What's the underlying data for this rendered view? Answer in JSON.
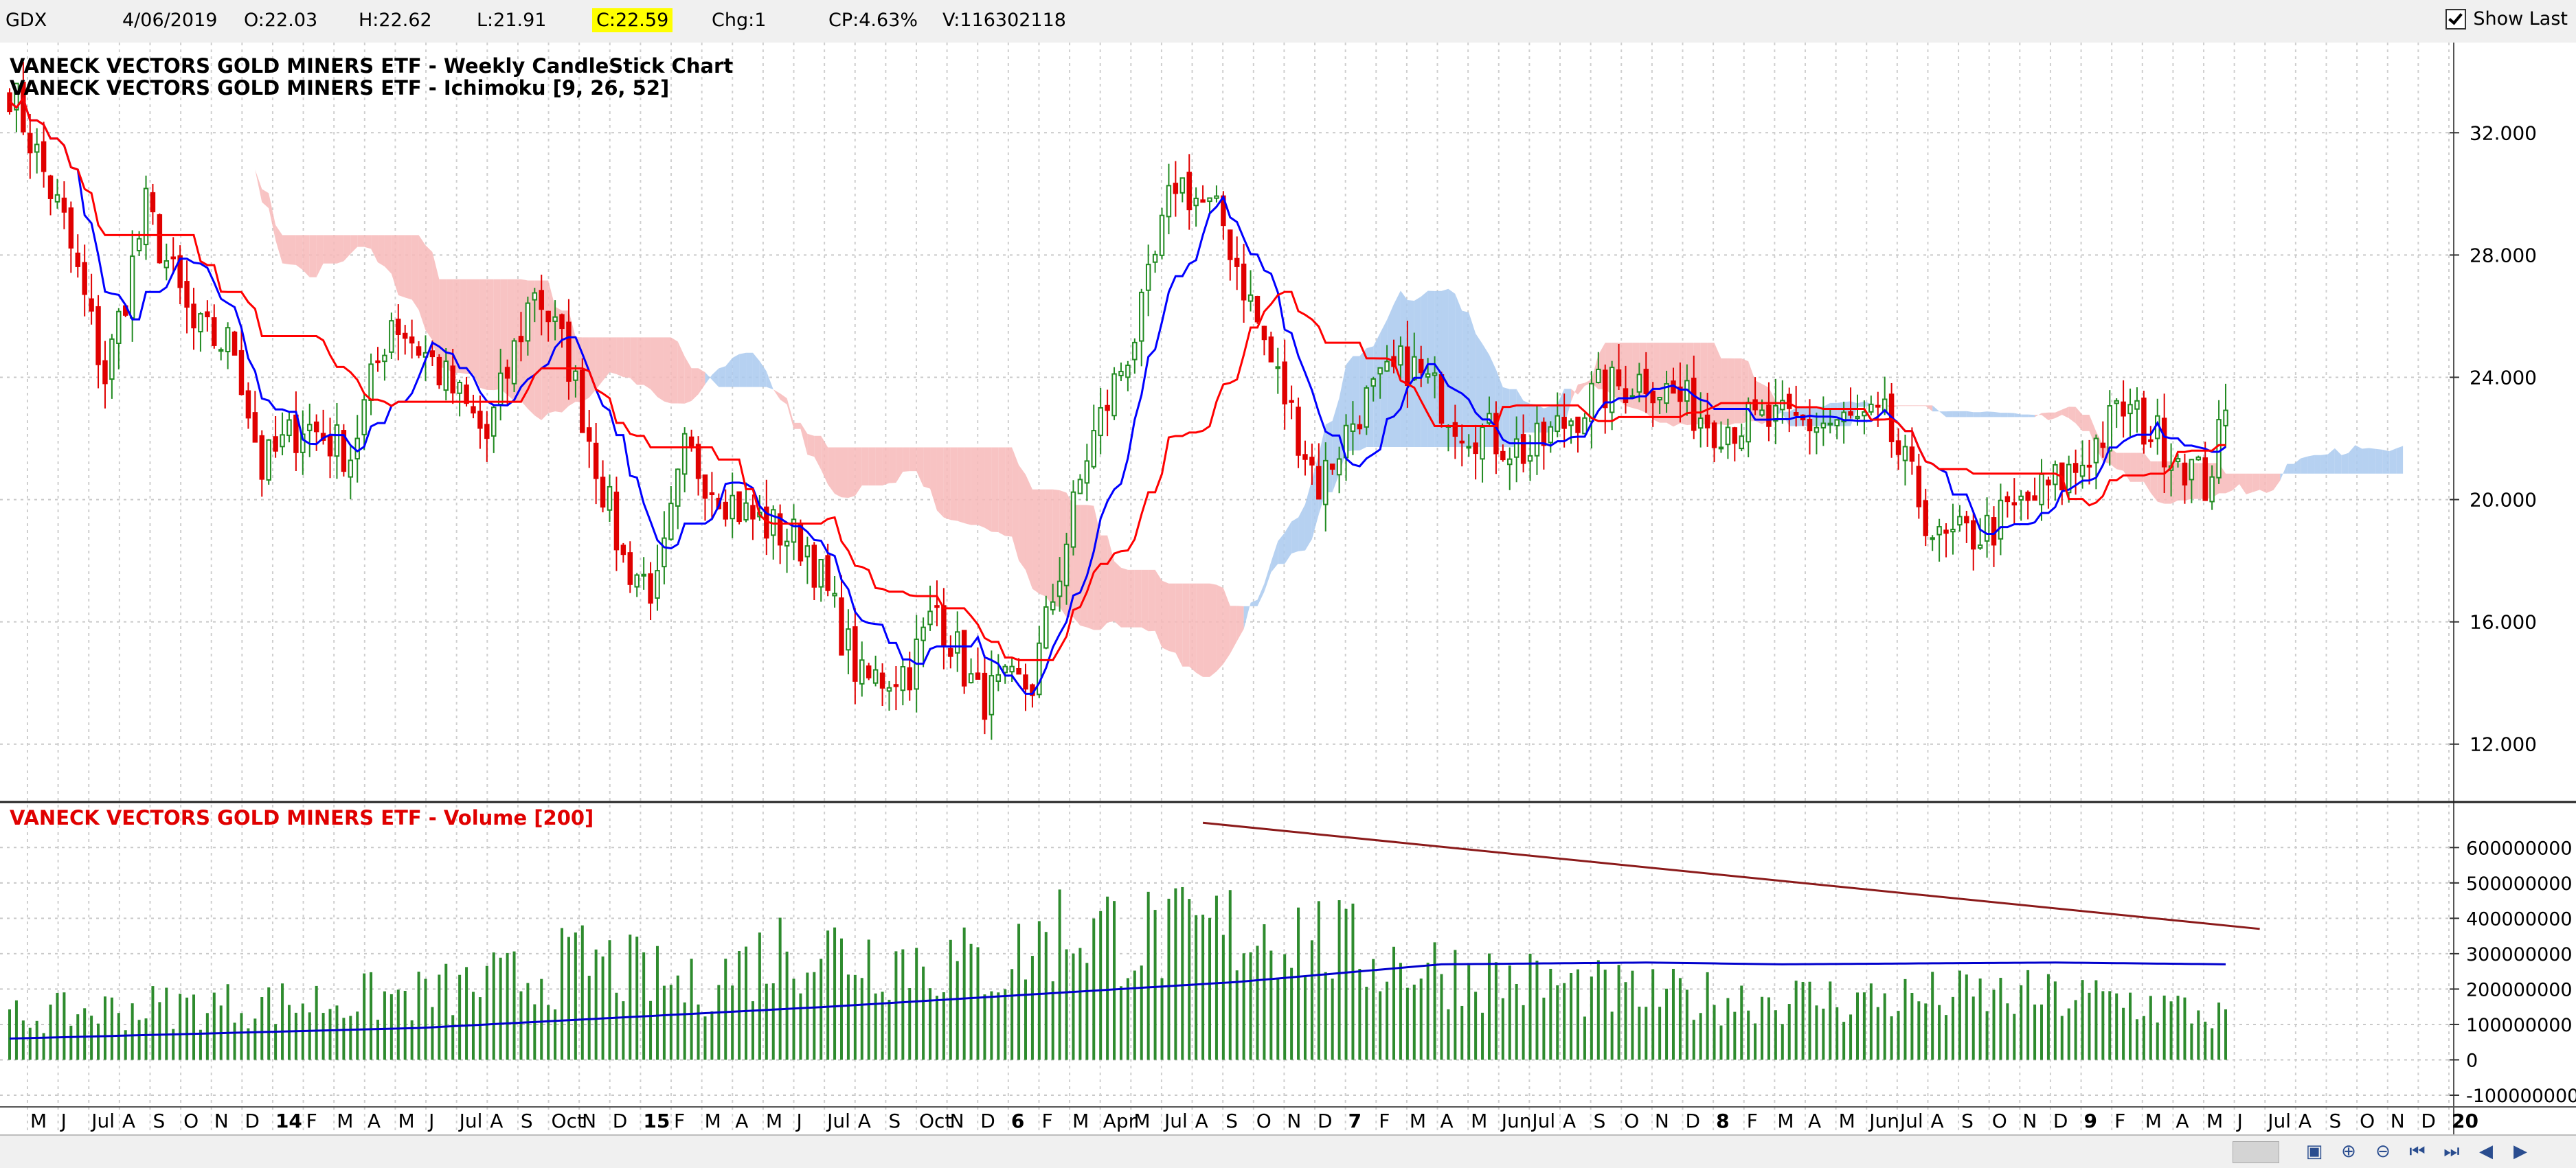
{
  "header": {
    "symbol": "GDX",
    "date": "4/06/2019",
    "open": "O:22.03",
    "high": "H:22.62",
    "low": "L:21.91",
    "close": "C:22.59",
    "change": "Chg:1",
    "change_pct": "CP:4.63%",
    "volume": "V:116302118",
    "show_last_label": "Show Last",
    "show_last_checked": true
  },
  "chart_data": [
    {
      "type": "candlestick",
      "title": "VANECK VECTORS GOLD MINERS ETF - Weekly CandleStick Chart",
      "subtitle": "VANECK VECTORS GOLD MINERS ETF - Ichimoku [9, 26, 52]",
      "ylim": [
        11.5,
        34.5
      ],
      "yticks": [
        "32.000",
        "28.000",
        "24.000",
        "20.000",
        "16.000",
        "12.000"
      ],
      "ytick_values": [
        32,
        28,
        24,
        20,
        16,
        12
      ],
      "up_color": "#228b22",
      "down_color": "#e00000",
      "tenkan_color": "#0000ff",
      "kijun_color": "#ff0000",
      "cloud_bear_color": "#f7b9b9",
      "cloud_bull_color": "#a9c9ef",
      "close_anchors": [
        [
          0,
          33.5
        ],
        [
          8,
          29
        ],
        [
          14,
          24
        ],
        [
          20,
          29.5
        ],
        [
          27,
          25.5
        ],
        [
          33,
          25
        ],
        [
          37,
          21
        ],
        [
          43,
          22.5
        ],
        [
          50,
          21.5
        ],
        [
          56,
          26
        ],
        [
          62,
          24.5
        ],
        [
          70,
          22
        ],
        [
          77,
          27
        ],
        [
          82,
          24.5
        ],
        [
          90,
          18
        ],
        [
          95,
          17
        ],
        [
          99,
          21.5
        ],
        [
          108,
          19.5
        ],
        [
          117,
          18.5
        ],
        [
          125,
          14
        ],
        [
          132,
          14.5
        ],
        [
          136,
          16.5
        ],
        [
          142,
          13.5
        ],
        [
          150,
          14
        ],
        [
          158,
          21.5
        ],
        [
          166,
          26
        ],
        [
          171,
          30.5
        ],
        [
          178,
          29
        ],
        [
          185,
          24.5
        ],
        [
          192,
          20.5
        ],
        [
          198,
          23
        ],
        [
          205,
          24.5
        ],
        [
          213,
          22.5
        ],
        [
          223,
          21.5
        ],
        [
          233,
          23.5
        ],
        [
          240,
          24
        ],
        [
          250,
          22.5
        ],
        [
          260,
          22.5
        ],
        [
          275,
          22.5
        ],
        [
          283,
          18.5
        ],
        [
          290,
          19
        ],
        [
          303,
          21
        ],
        [
          310,
          23
        ],
        [
          318,
          21.5
        ],
        [
          322,
          20.5
        ],
        [
          325,
          22.6
        ]
      ],
      "date_labels": [
        "M",
        "J",
        "Jul",
        "A",
        "S",
        "O",
        "N",
        "D",
        "14",
        "F",
        "M",
        "A",
        "M",
        "J",
        "Jul",
        "A",
        "S",
        "Oct",
        "N",
        "D",
        "15",
        "F",
        "M",
        "A",
        "M",
        "J",
        "Jul",
        "A",
        "S",
        "Oct",
        "N",
        "D",
        "6",
        "F",
        "M",
        "Apr",
        "M",
        "Jul",
        "A",
        "S",
        "O",
        "N",
        "D",
        "7",
        "F",
        "M",
        "A",
        "M",
        "Jun",
        "Jul",
        "A",
        "S",
        "O",
        "N",
        "D",
        "8",
        "F",
        "M",
        "A",
        "M",
        "Jun",
        "Jul",
        "A",
        "S",
        "O",
        "N",
        "D",
        "9",
        "F",
        "M",
        "A",
        "M",
        "J",
        "Jul",
        "A",
        "S",
        "O",
        "N",
        "D",
        "20"
      ],
      "year_labels": [
        "14",
        "15",
        "6",
        "7",
        "8",
        "9",
        "20"
      ]
    },
    {
      "type": "bar",
      "title": "VANECK VECTORS GOLD MINERS ETF - Volume [200]",
      "ylim": [
        -100000000,
        620000000
      ],
      "yticks": [
        "600000000",
        "500000000",
        "400000000",
        "300000000",
        "200000000",
        "100000000",
        "0",
        "-100000000"
      ],
      "ytick_values": [
        600000000,
        500000000,
        400000000,
        300000000,
        200000000,
        100000000,
        0,
        -100000000
      ],
      "bar_color": "#2e8b2e",
      "ma_color": "#0000cc",
      "trendline_color": "#8b1a1a",
      "volume_anchors": [
        [
          0,
          120000000
        ],
        [
          20,
          150000000
        ],
        [
          40,
          160000000
        ],
        [
          60,
          180000000
        ],
        [
          75,
          230000000
        ],
        [
          85,
          280000000
        ],
        [
          100,
          200000000
        ],
        [
          115,
          330000000
        ],
        [
          125,
          300000000
        ],
        [
          145,
          260000000
        ],
        [
          155,
          380000000
        ],
        [
          170,
          340000000
        ],
        [
          185,
          380000000
        ],
        [
          200,
          290000000
        ],
        [
          215,
          240000000
        ],
        [
          240,
          180000000
        ],
        [
          270,
          170000000
        ],
        [
          290,
          180000000
        ],
        [
          310,
          170000000
        ],
        [
          325,
          120000000
        ]
      ],
      "ma_anchors": [
        [
          0,
          60000000
        ],
        [
          60,
          90000000
        ],
        [
          120,
          150000000
        ],
        [
          180,
          220000000
        ],
        [
          210,
          270000000
        ],
        [
          240,
          275000000
        ],
        [
          260,
          270000000
        ],
        [
          300,
          275000000
        ],
        [
          325,
          270000000
        ]
      ],
      "trendline": {
        "from": [
          175,
          670000000
        ],
        "to": [
          330,
          370000000
        ]
      }
    }
  ]
}
